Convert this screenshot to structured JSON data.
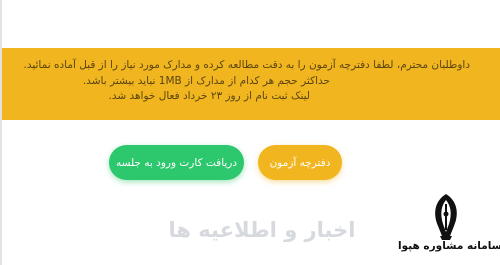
{
  "notice": {
    "lines": [
      "داوطلبان محترم، لطفا دفترچه آزمون را به دقت مطالعه کرده و مدارک مورد نیاز را از قبل آماده نمائید.",
      "حداکثر حجم هر کدام از مدارک از 1MB نباید بیشتر باشد.",
      "لینک ثبت نام از روز ۲۳ خرداد فعال خواهد شد."
    ],
    "background": "#f0b51f"
  },
  "buttons": {
    "booklet_label": "دفترچه آزمون",
    "card_label": "دریافت کارت ورود به جلسه",
    "booklet_color": "#f0b51f",
    "card_color": "#2dc76d"
  },
  "section": {
    "news_title": "اخبار و اطلاعیه ها"
  },
  "watermark": {
    "icon": "quill-pen-logo-icon",
    "text": "سامانه مشاوره هپوا"
  }
}
